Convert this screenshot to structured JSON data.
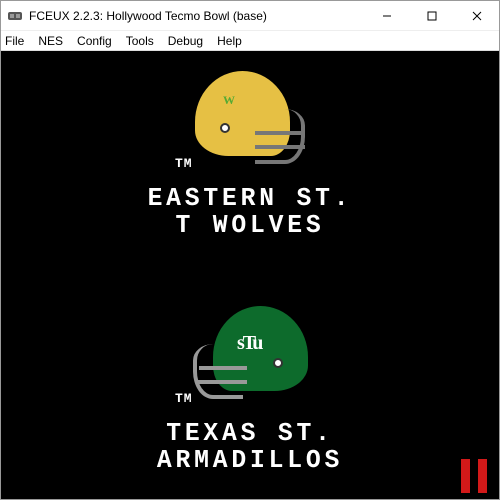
{
  "window": {
    "title": "FCEUX 2.2.3: Hollywood Tecmo Bowl (base)"
  },
  "menu": {
    "items": [
      "File",
      "NES",
      "Config",
      "Tools",
      "Debug",
      "Help"
    ]
  },
  "game": {
    "trademark": "TM",
    "teams": [
      {
        "helmet_color": "#e6c044",
        "helmet_facing": "right",
        "logo_text": "W",
        "name_line1": "EASTERN ST.",
        "name_line2": "T WOLVES"
      },
      {
        "helmet_color": "#0d6b2c",
        "helmet_facing": "left",
        "logo_text": "sTu",
        "name_line1": "TEXAS ST.",
        "name_line2": "ARMADILLOS"
      }
    ],
    "status": "paused"
  }
}
